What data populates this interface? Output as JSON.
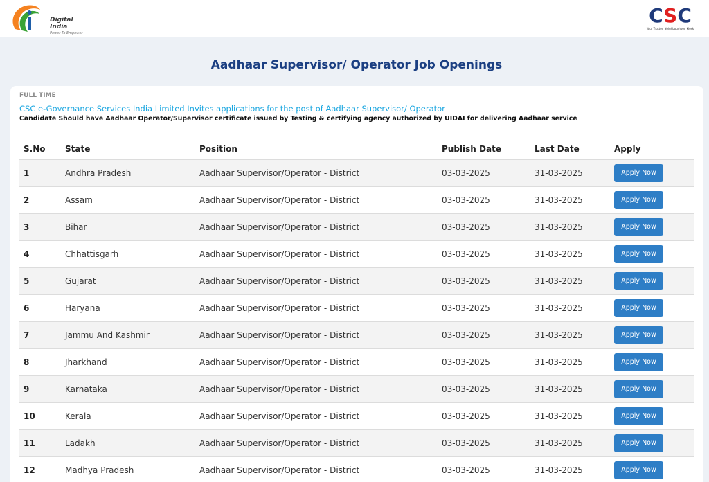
{
  "header": {
    "digital_india_name": "Digital India",
    "digital_india_tagline": "Power To Empower",
    "csc_logo_text": "CSC",
    "csc_tagline": "Your Trusted Neighbourhood Kiosk"
  },
  "page_title": "Aadhaar Supervisor/ Operator Job Openings",
  "job": {
    "type": "FULL TIME",
    "heading": "CSC e-Governance Services India Limited Invites applications for the post of Aadhaar Supervisor/ Operator",
    "description": "Candidate Should have Aadhaar Operator/Supervisor certificate issued by Testing & certifying agency authorized by UIDAI for delivering Aadhaar service"
  },
  "table": {
    "columns": [
      "S.No",
      "State",
      "Position",
      "Publish Date",
      "Last Date",
      "Apply"
    ],
    "apply_label": "Apply Now",
    "rows": [
      {
        "sno": "1",
        "state": "Andhra Pradesh",
        "position": "Aadhaar Supervisor/Operator - District",
        "publish": "03-03-2025",
        "last": "31-03-2025"
      },
      {
        "sno": "2",
        "state": "Assam",
        "position": "Aadhaar Supervisor/Operator - District",
        "publish": "03-03-2025",
        "last": "31-03-2025"
      },
      {
        "sno": "3",
        "state": "Bihar",
        "position": "Aadhaar Supervisor/Operator - District",
        "publish": "03-03-2025",
        "last": "31-03-2025"
      },
      {
        "sno": "4",
        "state": "Chhattisgarh",
        "position": "Aadhaar Supervisor/Operator - District",
        "publish": "03-03-2025",
        "last": "31-03-2025"
      },
      {
        "sno": "5",
        "state": "Gujarat",
        "position": "Aadhaar Supervisor/Operator - District",
        "publish": "03-03-2025",
        "last": "31-03-2025"
      },
      {
        "sno": "6",
        "state": "Haryana",
        "position": "Aadhaar Supervisor/Operator - District",
        "publish": "03-03-2025",
        "last": "31-03-2025"
      },
      {
        "sno": "7",
        "state": "Jammu And Kashmir",
        "position": "Aadhaar Supervisor/Operator - District",
        "publish": "03-03-2025",
        "last": "31-03-2025"
      },
      {
        "sno": "8",
        "state": "Jharkhand",
        "position": "Aadhaar Supervisor/Operator - District",
        "publish": "03-03-2025",
        "last": "31-03-2025"
      },
      {
        "sno": "9",
        "state": "Karnataka",
        "position": "Aadhaar Supervisor/Operator - District",
        "publish": "03-03-2025",
        "last": "31-03-2025"
      },
      {
        "sno": "10",
        "state": "Kerala",
        "position": "Aadhaar Supervisor/Operator - District",
        "publish": "03-03-2025",
        "last": "31-03-2025"
      },
      {
        "sno": "11",
        "state": "Ladakh",
        "position": "Aadhaar Supervisor/Operator - District",
        "publish": "03-03-2025",
        "last": "31-03-2025"
      },
      {
        "sno": "12",
        "state": "Madhya Pradesh",
        "position": "Aadhaar Supervisor/Operator - District",
        "publish": "03-03-2025",
        "last": "31-03-2025"
      }
    ]
  },
  "colors": {
    "title": "#1b3f82",
    "heading_link": "#1aa6e0",
    "button": "#2e7ec6",
    "background": "#edf1f6"
  }
}
